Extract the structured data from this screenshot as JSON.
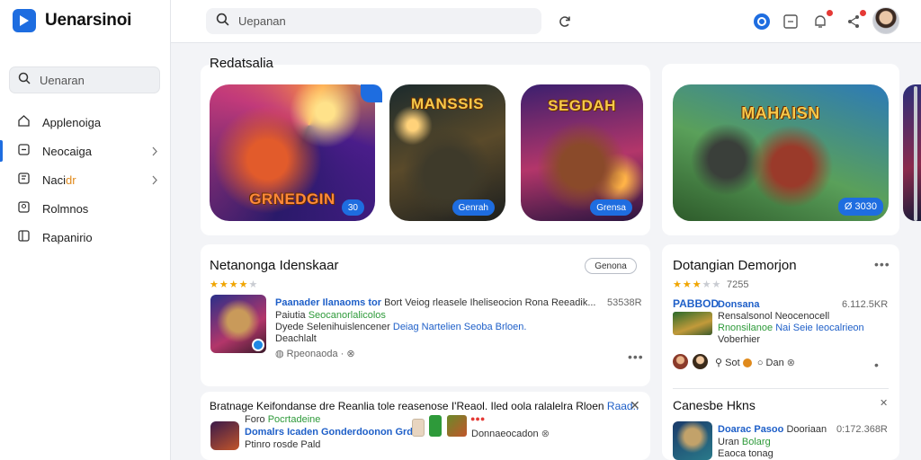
{
  "brand": {
    "name": "Uenarsinoi",
    "logo_icon": "play-icon",
    "accent": "#1e6de0"
  },
  "sidebar": {
    "search_placeholder": "Uenaran",
    "items": [
      {
        "label": "Applenoiga",
        "icon": "home-icon",
        "active": false,
        "chevron": false
      },
      {
        "label": "Neocaiga",
        "icon": "grid-icon",
        "active": true,
        "chevron": true
      },
      {
        "label_pre": "Naci",
        "label_accent": "dr",
        "icon": "bookmark-icon",
        "active": false,
        "chevron": true
      },
      {
        "label": "Rolmnos",
        "icon": "people-icon",
        "active": false,
        "chevron": false
      },
      {
        "label": "Rapanirio",
        "icon": "library-icon",
        "active": false,
        "chevron": false
      }
    ]
  },
  "header": {
    "search_placeholder": "Uepanan",
    "icons": [
      "refresh-icon",
      "account-circle-icon",
      "message-icon",
      "bell-icon",
      "share-icon"
    ]
  },
  "section": {
    "title": "Redatsalia"
  },
  "carousel": [
    {
      "title": "GRNEDGIN",
      "badge": "30"
    },
    {
      "title": "MANSSIS",
      "badge": "Genrah"
    },
    {
      "title": "SEGDAH",
      "badge": "Grensa"
    }
  ],
  "featured": {
    "title": "MAHAISN",
    "badge": "Ø 3030"
  },
  "card_left": {
    "title": "Netanonga Idenskaar",
    "button": "Genona",
    "rating": 4,
    "item": {
      "name": "Paanader Ilanaoms tor",
      "desc": "Bort Veiog rleasele Iheliseocion Rona Reeadik...",
      "size": "53538R",
      "line2_pre": "Paiutia",
      "line2_green": "Seocanorlalicolos",
      "line3_pre": "Dyede Selenihuislencener",
      "line3_blue": "Deiag Nartelien Seoba Brloen.",
      "line4": "Deachlalt",
      "meta": "Rpeonaoda"
    }
  },
  "card_left_bottom": {
    "title_pre": "Bratnage Keifondanse dre Reanlia tole reasenose I'Reaol. Iled oola ralalelra Rloen",
    "title_link": "Raad..",
    "item": {
      "line1_pre": "Foro",
      "line1_green": "Pocrtadeine",
      "line2_blue": "Domalrs Icaden Gonderdoonon Grda",
      "line3": "Ptinro rosde Pald",
      "meta": "Donnaeocadon"
    }
  },
  "card_right": {
    "title": "Dotangian Demorjon",
    "rating": 3,
    "rating_text": "7255",
    "item": {
      "tag": "PABBOD",
      "name": "Donsana",
      "size": "6.112.5KR",
      "line2": "Rensalsonol Neocenocell",
      "line3_green": "Rnonsilanoe",
      "line3_blue": "Nai Seie Ieocalrieon",
      "line4": "Voberhier",
      "meta_a": "Sot",
      "meta_b": "Dan"
    }
  },
  "card_right_bottom": {
    "title": "Canesbe Hkns",
    "item": {
      "name_blue": "Doarac Pasoo",
      "name_rest": "Dooriaan",
      "size": "0:172.368R",
      "line2_pre": "Uran",
      "line2_green": "Bolarg",
      "line3": "Eaoca tonag"
    }
  },
  "colors": {
    "star": "#f0a500",
    "link": "#1e5fc8",
    "green": "#2e9a3a",
    "badge": "#e53935"
  }
}
